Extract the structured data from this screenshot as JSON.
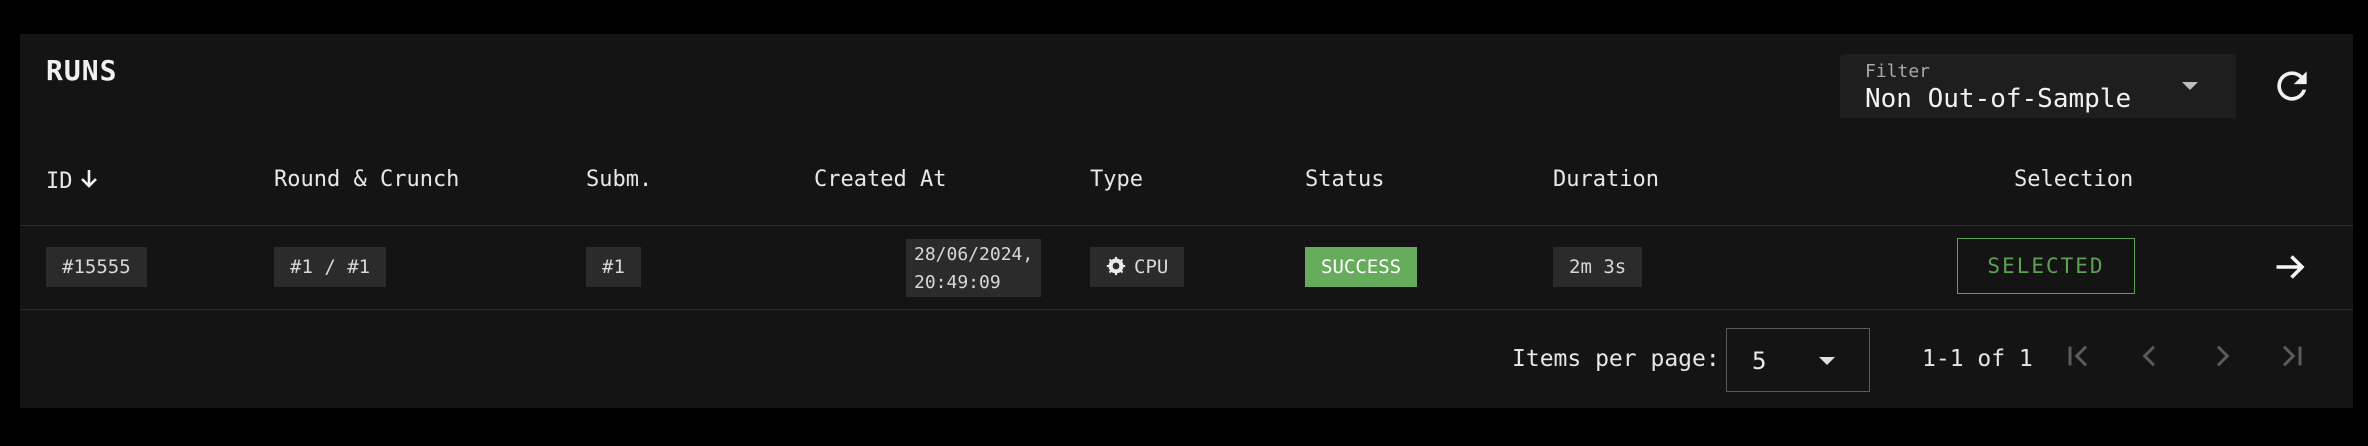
{
  "header": {
    "title": "RUNS"
  },
  "filter": {
    "label": "Filter",
    "value": "Non Out-of-Sample"
  },
  "columns": {
    "id": "ID",
    "round_crunch": "Round & Crunch",
    "subm": "Subm.",
    "created_at": "Created At",
    "type": "Type",
    "status": "Status",
    "duration": "Duration",
    "selection": "Selection"
  },
  "rows": [
    {
      "id": "#15555",
      "round_crunch": "#1 / #1",
      "subm": "#1",
      "created_at": "28/06/2024,\n20:49:09",
      "type": "CPU",
      "status": "SUCCESS",
      "duration": "2m 3s",
      "selection": "SELECTED"
    }
  ],
  "pagination": {
    "items_per_page_label": "Items per page:",
    "items_per_page": "5",
    "range": "1-1 of 1"
  },
  "colors": {
    "background": "#000000",
    "panel": "#141414",
    "success": "#67ab5c",
    "selected_border": "#5aa351"
  },
  "icons": {
    "sort": "arrow-down-icon",
    "refresh": "refresh-icon",
    "type": "gear-icon",
    "row_action": "arrow-right-icon",
    "first": "first-page-icon",
    "prev": "chevron-left-icon",
    "next": "chevron-right-icon",
    "last": "last-page-icon"
  }
}
